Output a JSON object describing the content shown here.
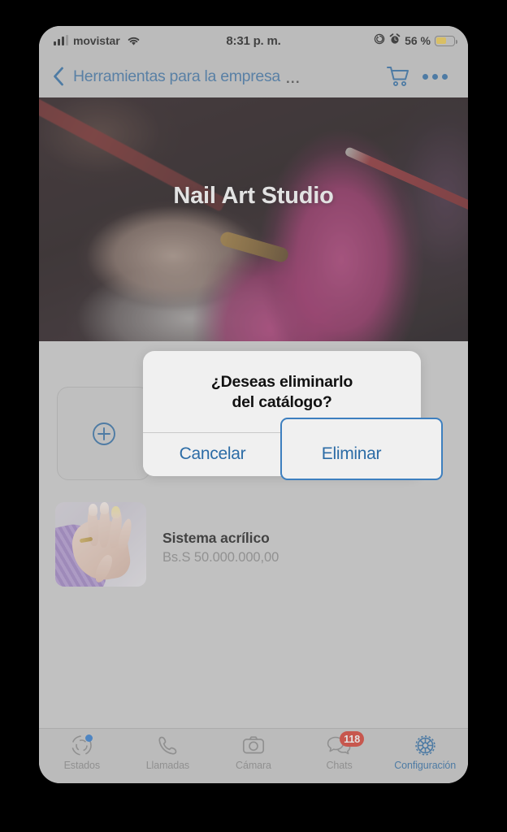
{
  "status_bar": {
    "carrier": "movistar",
    "time": "8:31 p. m.",
    "battery_percent": "56 %",
    "battery_level": 56,
    "battery_color": "#f2cd4b",
    "icons": [
      "cellular-signal-icon",
      "wifi-icon",
      "rotation-lock-icon",
      "alarm-icon",
      "battery-icon"
    ]
  },
  "nav_bar": {
    "back_icon": "chevron-left-icon",
    "title": "Herramientas para la empresa",
    "title_ellipsis": "...",
    "cart_icon": "shopping-cart-icon",
    "more_label": "•••",
    "tint_color": "#2c6ca6"
  },
  "hero": {
    "title": "Nail Art Studio",
    "image_description": "nail-art-photo"
  },
  "catalog": {
    "add_card_icon": "plus-circle-icon",
    "products": [
      {
        "name": "Sistema acrílico",
        "price": "Bs.S 50.000.000,00",
        "thumbnail": "hand-nails-photo"
      }
    ]
  },
  "alert": {
    "title": "¿Deseas eliminarlo\ndel catálogo?",
    "cancel_label": "Cancelar",
    "confirm_label": "Eliminar",
    "focused_button": "Eliminar",
    "accent_color": "#2c6ca6",
    "focus_border_color": "#3d7fbf"
  },
  "tab_bar": {
    "active_tab": "Configuración",
    "tabs": [
      {
        "label": "Estados",
        "icon": "status-ring-icon",
        "badge": null,
        "dot": true
      },
      {
        "label": "Llamadas",
        "icon": "phone-icon",
        "badge": null,
        "dot": false
      },
      {
        "label": "Cámara",
        "icon": "camera-icon",
        "badge": null,
        "dot": false
      },
      {
        "label": "Chats",
        "icon": "chat-bubbles-icon",
        "badge": "118",
        "dot": false
      },
      {
        "label": "Configuración",
        "icon": "gear-icon",
        "badge": null,
        "dot": false
      }
    ],
    "badge_color": "#d9392b",
    "active_color": "#2c6ca6",
    "inactive_color": "#8a8a8a"
  }
}
